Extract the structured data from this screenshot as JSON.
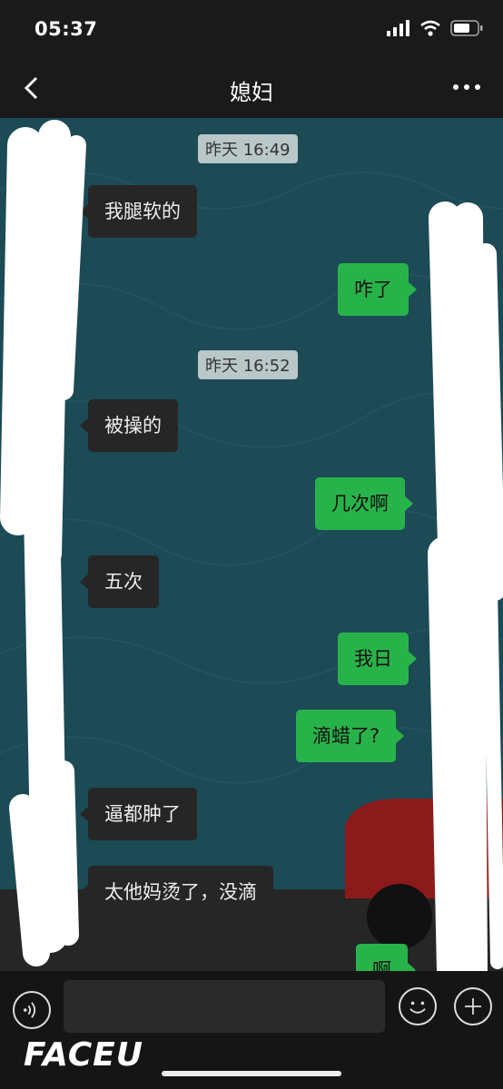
{
  "status_bar": {
    "time": "05:37"
  },
  "nav": {
    "title": "媳妇"
  },
  "messages": [
    {
      "kind": "timestamp",
      "text": "昨天 16:49"
    },
    {
      "kind": "incoming",
      "text": "我腿软的"
    },
    {
      "kind": "outgoing",
      "text": "咋了"
    },
    {
      "kind": "timestamp",
      "text": "昨天 16:52"
    },
    {
      "kind": "incoming",
      "text": "被操的"
    },
    {
      "kind": "outgoing",
      "text": "几次啊"
    },
    {
      "kind": "incoming",
      "text": "五次"
    },
    {
      "kind": "outgoing",
      "text": "我日"
    },
    {
      "kind": "outgoing",
      "text": "滴蜡了?"
    },
    {
      "kind": "incoming",
      "text": "逼都肿了"
    },
    {
      "kind": "incoming",
      "text": "太他妈烫了，没滴"
    },
    {
      "kind": "outgoing",
      "text": "啊"
    }
  ],
  "watermark": {
    "text": "FACEU"
  },
  "colors": {
    "chat_bg": "#1c4a55",
    "outgoing_bubble": "#28b34a",
    "incoming_bubble": "#262626",
    "bar_bg": "#1a1a1a"
  },
  "icons": [
    "back-icon",
    "more-icon",
    "signal-icon",
    "wifi-icon",
    "battery-icon",
    "voice-icon",
    "emoji-icon",
    "plus-icon"
  ]
}
